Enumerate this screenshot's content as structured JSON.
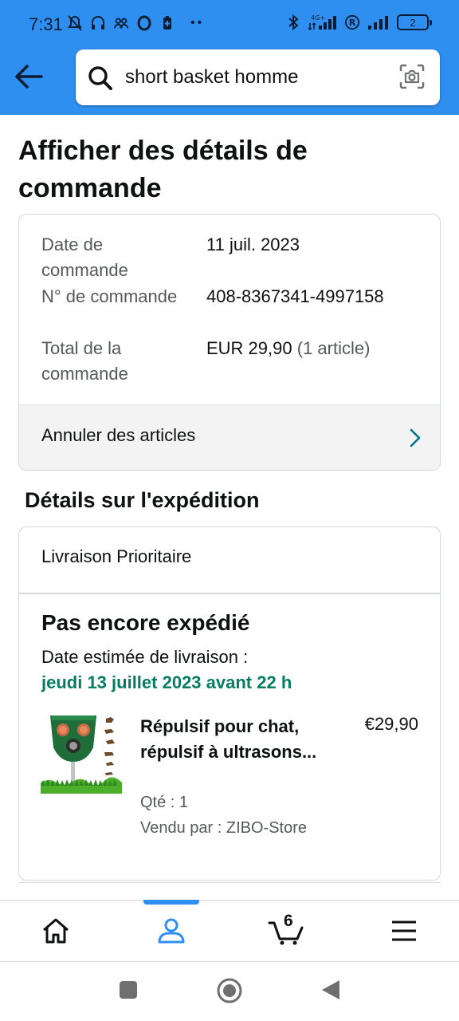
{
  "status_bar": {
    "time": "7:31",
    "icons": [
      "mute-icon",
      "headset-icon",
      "group-icon",
      "opera-icon",
      "battery-saver-icon",
      "more-dots-icon",
      "bluetooth-icon",
      "signal-4g-icon",
      "registered-icon",
      "signal-icon",
      "battery-icon"
    ],
    "battery_level": "2"
  },
  "header": {
    "back_icon": "arrow-left-icon",
    "search_query": "short basket homme",
    "search_icon": "search-icon",
    "camera_icon": "camera-scan-icon"
  },
  "page": {
    "title": "Afficher des détails de commande"
  },
  "order_summary": {
    "date_label": "Date de commande",
    "date_value": "11 juil. 2023",
    "number_label": "N° de commande",
    "number_value": "408-8367341-4997158",
    "total_label": "Total de la commande",
    "total_value": "EUR 29,90",
    "total_count": "(1 article)",
    "cancel_label": "Annuler des articles"
  },
  "shipment": {
    "section_title": "Détails sur l'expédition",
    "method": "Livraison Prioritaire",
    "status": "Pas encore expédié",
    "estimated_label": "Date estimée de livraison :",
    "estimated_date": "jeudi 13 juillet 2023 avant 22 h",
    "item": {
      "title": "Répulsif pour chat, répulsif à ultrasons...",
      "price": "€29,90",
      "quantity": "Qté : 1",
      "seller": "Vendu par : ZIBO-Store"
    }
  },
  "bottom_nav": {
    "items": [
      "home-icon",
      "account-icon",
      "cart-icon",
      "menu-icon"
    ],
    "active": "account-icon",
    "cart_count": "6"
  },
  "system_nav": [
    "recent-apps-icon",
    "home-button-icon",
    "back-icon"
  ],
  "colors": {
    "header_bg": "#2f8ff0",
    "delivery_green": "#067d62",
    "link_teal": "#007185",
    "active_blue": "#2f8ff0"
  }
}
